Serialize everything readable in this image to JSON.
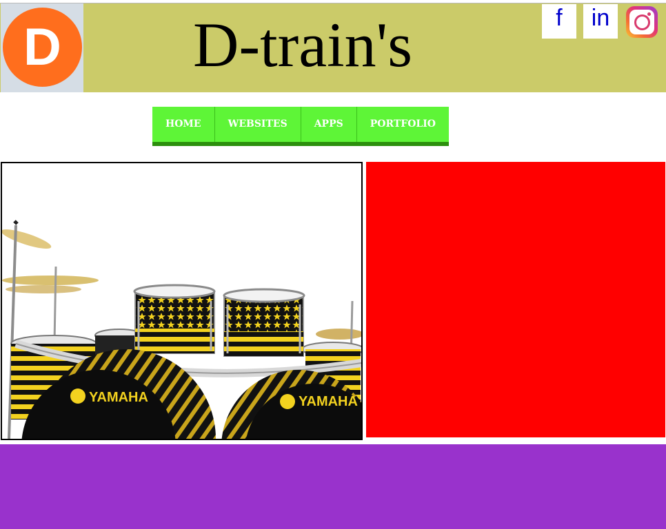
{
  "header": {
    "logo_letter": "D",
    "title": "D-train's",
    "background_color": "#cbcb69"
  },
  "social": {
    "facebook": "f",
    "linkedin": "in",
    "instagram_icon": "instagram-icon"
  },
  "nav": {
    "items": [
      {
        "label": "HOME"
      },
      {
        "label": "WEBSITES"
      },
      {
        "label": "APPS"
      },
      {
        "label": "PORTFOLIO"
      }
    ],
    "color": "#5ef537"
  },
  "content": {
    "image": {
      "bass_drum_brand_left": "YAMAHA",
      "bass_drum_brand_right": "YAMAHA"
    },
    "side_panel_color": "#ff0000",
    "footer_band_color": "#9932cc"
  }
}
